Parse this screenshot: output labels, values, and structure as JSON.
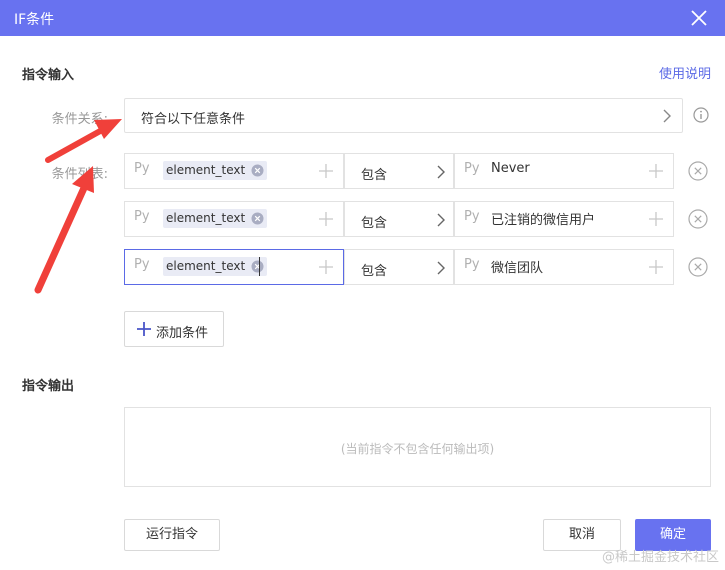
{
  "window": {
    "title": "IF条件"
  },
  "input_section": {
    "title": "指令输入",
    "help_link": "使用说明"
  },
  "relation": {
    "label": "条件关系:",
    "value": "符合以下任意条件"
  },
  "conditions_label": "条件列表:",
  "conditions": [
    {
      "prefix": "Py",
      "variable": "element_text",
      "operator": "包含",
      "value_prefix": "Py",
      "value": "Never"
    },
    {
      "prefix": "Py",
      "variable": "element_text",
      "operator": "包含",
      "value_prefix": "Py",
      "value": "已注销的微信用户"
    },
    {
      "prefix": "Py",
      "variable": "element_text",
      "operator": "包含",
      "value_prefix": "Py",
      "value": "微信团队"
    }
  ],
  "add_condition": "添加条件",
  "output_section": {
    "title": "指令输出",
    "empty_text": "(当前指令不包含任何输出项)"
  },
  "footer": {
    "run": "运行指令",
    "cancel": "取消",
    "ok": "确定"
  },
  "watermark": "@稀土掘金技术社区",
  "colors": {
    "accent": "#6872f0",
    "annotation": "#f0403a"
  }
}
